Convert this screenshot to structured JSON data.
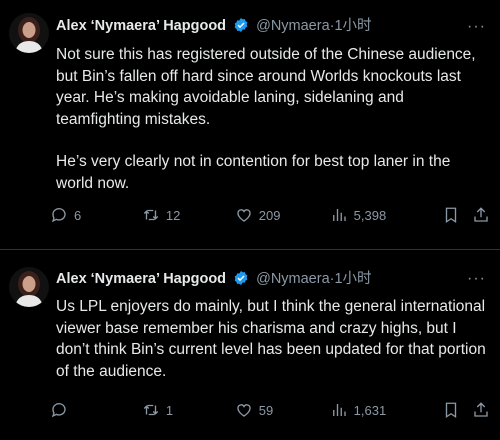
{
  "tweets": [
    {
      "author": {
        "name": "Alex ‘Nymaera’ Hapgood",
        "handle": "@Nymaera",
        "time": "1小时",
        "verified": true
      },
      "paragraphs": [
        "Not sure this has registered outside of the Chinese audience, but Bin’s fallen off hard since around Worlds knockouts last year. He’s making avoidable laning, sidelaning and teamfighting mistakes.",
        "He’s very clearly not in contention for best top laner in the world now."
      ],
      "stats": {
        "replies": "6",
        "retweets": "12",
        "likes": "209",
        "views": "5,398"
      }
    },
    {
      "author": {
        "name": "Alex ‘Nymaera’ Hapgood",
        "handle": "@Nymaera",
        "time": "1小时",
        "verified": true
      },
      "paragraphs": [
        "Us LPL enjoyers do mainly, but I think the general international viewer base remember his charisma and crazy highs, but I don’t think Bin’s current level has been updated for that portion of the audience."
      ],
      "stats": {
        "replies": "",
        "retweets": "1",
        "likes": "59",
        "views": "1,631"
      }
    }
  ],
  "icons": {
    "reply": "reply-icon",
    "retweet": "retweet-icon",
    "like": "heart-icon",
    "views": "views-icon",
    "bookmark": "bookmark-icon",
    "share": "share-icon",
    "verified": "verified-badge-icon",
    "more": "more-icon"
  },
  "colors": {
    "background": "#000000",
    "text": "#e7e9ea",
    "muted": "#8b98a5",
    "verified": "#1d9bf0"
  }
}
